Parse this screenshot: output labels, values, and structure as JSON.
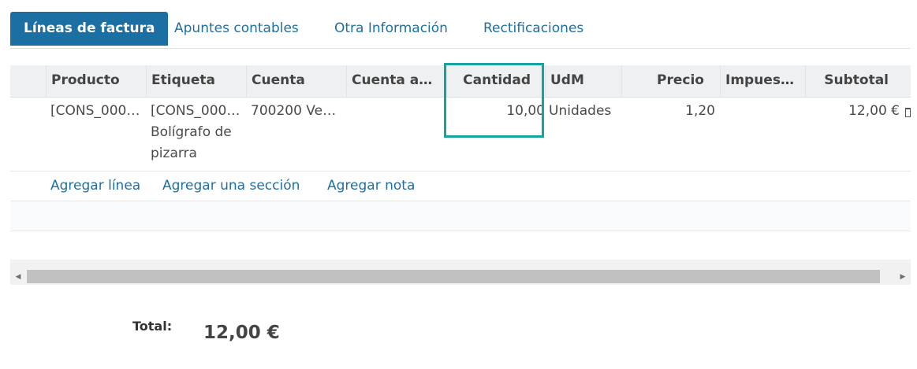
{
  "tabs": [
    {
      "label": "Líneas de factura",
      "active": true
    },
    {
      "label": "Apuntes contables"
    },
    {
      "label": "Otra Información"
    },
    {
      "label": "Rectificaciones"
    }
  ],
  "table": {
    "columns": [
      "Producto",
      "Etiqueta",
      "Cuenta",
      "Cuenta an…",
      "Cantidad",
      "UdM",
      "Precio",
      "Impuest…",
      "Subtotal"
    ],
    "row": {
      "producto": "[CONS_000…",
      "etiqueta_line1": "[CONS_000…",
      "etiqueta_line2": "Bolígrafo de",
      "etiqueta_line3": "pizarra",
      "cuenta": "700200 Ven…",
      "cuenta_analitica": "",
      "cantidad": "10,00",
      "udm": "Unidades",
      "precio": "1,20",
      "impuestos": "",
      "subtotal": "12,00 €"
    },
    "add_line": "Agregar línea",
    "add_section": "Agregar una sección",
    "add_note": "Agregar nota"
  },
  "totals": {
    "label": "Total:",
    "value": "12,00 €"
  },
  "colors": {
    "accent": "#1b6fa3",
    "link": "#1f6f9f",
    "highlight": "#14a39d"
  }
}
